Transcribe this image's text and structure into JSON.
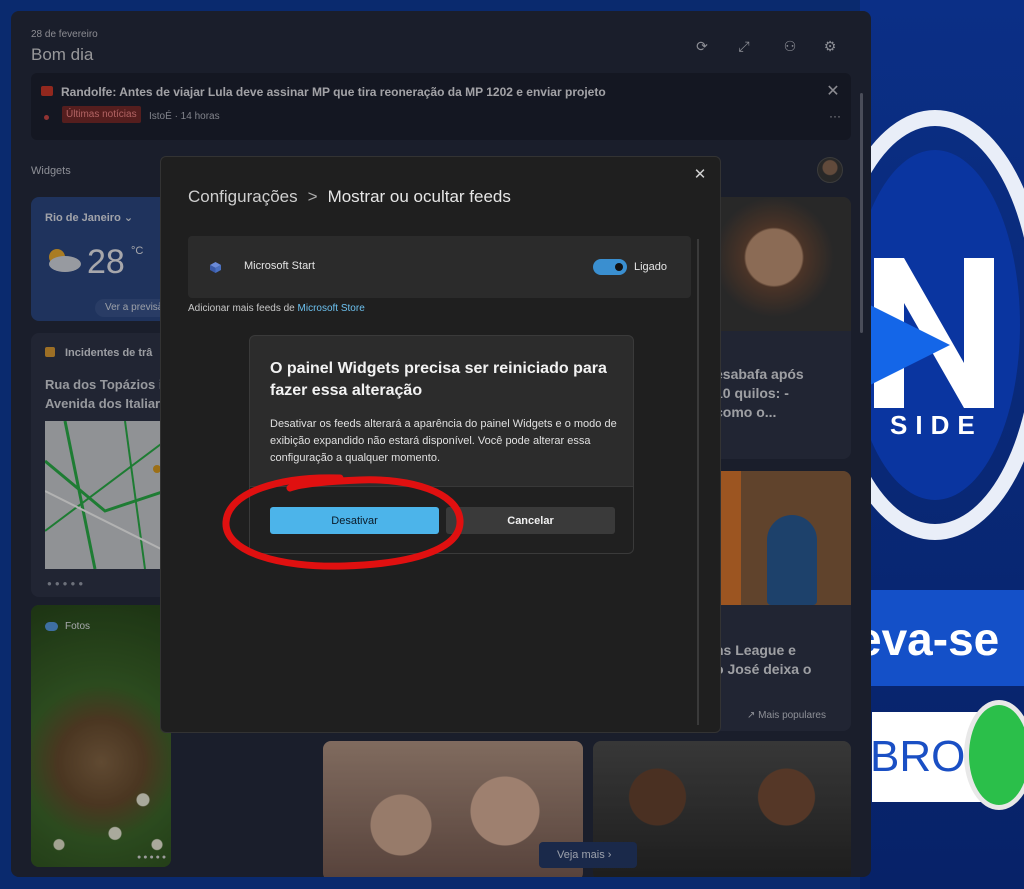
{
  "panel": {
    "date": "28 de fevereiro",
    "greeting": "Bom dia",
    "widgets_label": "Widgets"
  },
  "top_news": {
    "headline": "Randolfe: Antes de viajar Lula deve assinar MP que tira reoneração da MP 1202 e enviar projeto",
    "badge": "Últimas notícias",
    "source": "IstoÉ · 14 horas"
  },
  "weather": {
    "city": "Rio de Janeiro",
    "temperature": "28",
    "unit": "°C",
    "forecast_button": "Ver a previsã"
  },
  "traffic": {
    "title": "Incidentes de trâ",
    "address_line1": "Rua dos Topázios i",
    "address_line2": "Avenida dos Italiar"
  },
  "photos": {
    "label": "Fotos"
  },
  "news_cards": {
    "card1_line1": "esabafa após",
    "card1_line2": "10 quilos: -",
    "card1_line3": "como o...",
    "card2_line1": "ns League e",
    "card2_line2": "o José deixa o",
    "popular": "Mais populares",
    "see_more": "Veja mais"
  },
  "settings_dialog": {
    "crumb_root": "Configurações",
    "crumb_separator": ">",
    "crumb_current": "Mostrar ou ocultar feeds",
    "close_glyph": "✕",
    "feed_name": "Microsoft Start",
    "feed_state": "Ligado",
    "feed_enabled": true,
    "add_feeds_prefix": "Adicionar mais feeds de ",
    "add_feeds_link": "Microsoft Store"
  },
  "confirm_dialog": {
    "title": "O painel Widgets precisa ser reiniciado para fazer essa alteração",
    "body": "Desativar os feeds alterará a aparência do painel Widgets e o modo de exibição expandido não estará disponível. Você pode alterar essa configuração a qualquer momento.",
    "primary_button": "Desativar",
    "secondary_button": "Cancelar"
  },
  "background": {
    "brand_word": "SIDE",
    "banner_text": "eva-se",
    "membro_text": "BRO"
  },
  "colors": {
    "accent": "#4cb4ea",
    "annotation": "#e01010",
    "toggle_on": "#3a8fd0"
  }
}
